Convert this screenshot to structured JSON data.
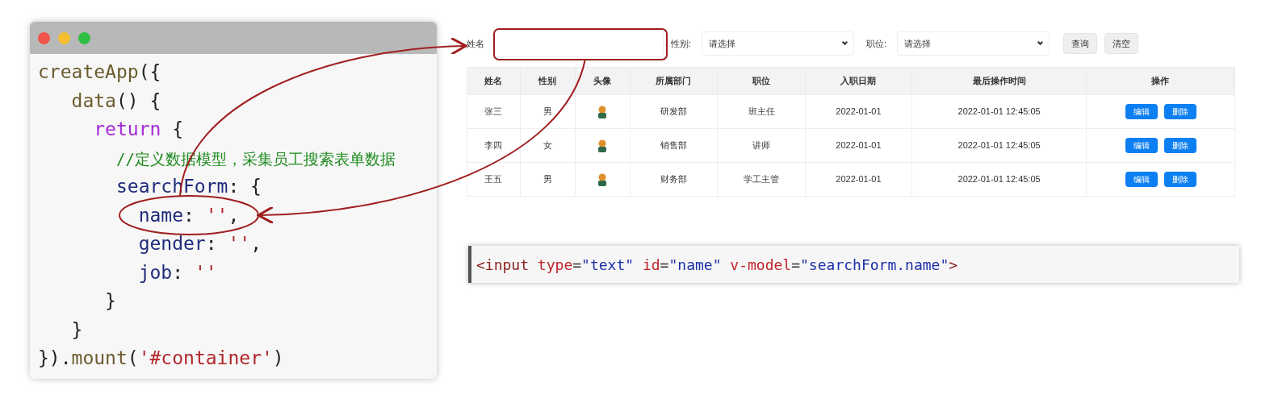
{
  "code_window": {
    "lines": [
      [
        {
          "text": "createApp",
          "kind": "func"
        },
        {
          "text": "({",
          "kind": "punct"
        }
      ],
      [
        {
          "text": "   data",
          "kind": "func"
        },
        {
          "text": "() {",
          "kind": "punct"
        }
      ],
      [
        {
          "text": "     return",
          "kind": "keyword"
        },
        {
          "text": " {",
          "kind": "punct"
        }
      ],
      [
        {
          "text": "       //定义数据模型，采集员工搜索表单数据",
          "kind": "comment"
        }
      ],
      [
        {
          "text": "       searchForm",
          "kind": "prop"
        },
        {
          "text": ": {",
          "kind": "punct"
        }
      ],
      [
        {
          "text": "         name",
          "kind": "prop"
        },
        {
          "text": ": ",
          "kind": "punct"
        },
        {
          "text": "''",
          "kind": "string"
        },
        {
          "text": ",",
          "kind": "punct"
        }
      ],
      [
        {
          "text": "         gender",
          "kind": "prop"
        },
        {
          "text": ": ",
          "kind": "punct"
        },
        {
          "text": "''",
          "kind": "string"
        },
        {
          "text": ",",
          "kind": "punct"
        }
      ],
      [
        {
          "text": "         job",
          "kind": "prop"
        },
        {
          "text": ": ",
          "kind": "punct"
        },
        {
          "text": "''",
          "kind": "string"
        }
      ],
      [
        {
          "text": "      }",
          "kind": "punct"
        }
      ],
      [
        {
          "text": "   }",
          "kind": "punct"
        }
      ],
      [
        {
          "text": "}).",
          "kind": "punct"
        },
        {
          "text": "mount",
          "kind": "func"
        },
        {
          "text": "(",
          "kind": "punct"
        },
        {
          "text": "'#container'",
          "kind": "string"
        },
        {
          "text": ")",
          "kind": "punct"
        }
      ]
    ]
  },
  "search_form": {
    "name_label": "姓名",
    "gender_label": "性别:",
    "gender_select": "请选择",
    "job_label": "职位:",
    "job_select": "请选择",
    "buttons": [
      "查询",
      "清空"
    ]
  },
  "table": {
    "columns": [
      "姓名",
      "性别",
      "头像",
      "所属部门",
      "职位",
      "入职日期",
      "最后操作时间",
      "操作"
    ],
    "rows": [
      {
        "name": "张三",
        "gender": "男",
        "department": "研发部",
        "job": "班主任",
        "entry_date": "2022-01-01",
        "last_update": "2022-01-01 12:45:05",
        "actions": [
          "编辑",
          "删除"
        ]
      },
      {
        "name": "李四",
        "gender": "女",
        "department": "销售部",
        "job": "讲师",
        "entry_date": "2022-01-01",
        "last_update": "2022-01-01 12:45:05",
        "actions": [
          "编辑",
          "删除"
        ]
      },
      {
        "name": "王五",
        "gender": "男",
        "department": "财务部",
        "job": "学工主管",
        "entry_date": "2022-01-01",
        "last_update": "2022-01-01 12:45:05",
        "actions": [
          "编辑",
          "删除"
        ]
      }
    ]
  },
  "snippet": [
    {
      "text": "<input",
      "kind": "tag"
    },
    {
      "text": " type",
      "kind": "attr"
    },
    {
      "text": "=",
      "kind": "punct"
    },
    {
      "text": "\"text\"",
      "kind": "value"
    },
    {
      "text": " id",
      "kind": "attr"
    },
    {
      "text": "=",
      "kind": "punct"
    },
    {
      "text": "\"name\"",
      "kind": "value"
    },
    {
      "text": " v-model",
      "kind": "attr"
    },
    {
      "text": "=",
      "kind": "punct"
    },
    {
      "text": "\"searchForm.name\"",
      "kind": "value"
    },
    {
      "text": ">",
      "kind": "tag"
    }
  ]
}
